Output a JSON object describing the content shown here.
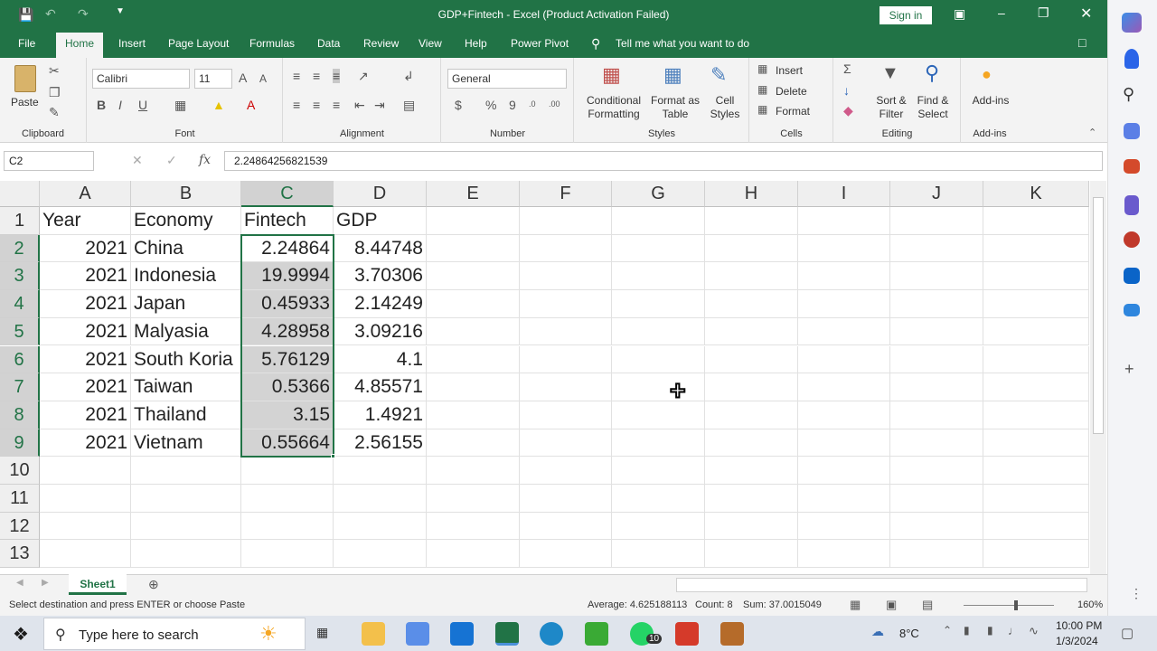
{
  "window": {
    "title": "GDP+Fintech  -  Excel (Product Activation Failed)",
    "sign_in": "Sign in"
  },
  "tabs": [
    "File",
    "Home",
    "Insert",
    "Page Layout",
    "Formulas",
    "Data",
    "Review",
    "View",
    "Help",
    "Power Pivot"
  ],
  "tell_me": "Tell me what you want to do",
  "ribbon": {
    "clipboard": {
      "paste": "Paste",
      "label": "Clipboard"
    },
    "font": {
      "name": "Calibri",
      "size": "11",
      "label": "Font",
      "bold": "B",
      "italic": "I",
      "underline": "U"
    },
    "alignment": {
      "label": "Alignment"
    },
    "number": {
      "format": "General",
      "label": "Number",
      "currency": "$",
      "percent": "%",
      "comma": "9"
    },
    "styles": {
      "conditional": "Conditional Formatting",
      "format_table": "Format as Table",
      "cell_styles": "Cell Styles",
      "label": "Styles"
    },
    "cells": {
      "insert": "Insert",
      "delete": "Delete",
      "format": "Format",
      "label": "Cells"
    },
    "editing": {
      "sort": "Sort & Filter",
      "find": "Find & Select",
      "label": "Editing"
    },
    "addins": {
      "addins": "Add-ins",
      "label": "Add-ins"
    }
  },
  "formula_bar": {
    "name_box": "C2",
    "fx": "fx",
    "value": "2.24864256821539"
  },
  "columns": [
    "A",
    "B",
    "C",
    "D",
    "E",
    "F",
    "G",
    "H",
    "I",
    "J",
    "K"
  ],
  "rows": [
    "1",
    "2",
    "3",
    "4",
    "5",
    "6",
    "7",
    "8",
    "9",
    "10",
    "11",
    "12",
    "13"
  ],
  "cells": [
    [
      "Year",
      "Economy",
      "Fintech",
      "GDP"
    ],
    [
      "2021",
      "China",
      "2.24864",
      "8.44748"
    ],
    [
      "2021",
      "Indonesia",
      "19.9994",
      "3.70306"
    ],
    [
      "2021",
      "Japan",
      "0.45933",
      "2.14249"
    ],
    [
      "2021",
      "Malyasia",
      "4.28958",
      "3.09216"
    ],
    [
      "2021",
      "South Koria",
      "5.76129",
      "4.1"
    ],
    [
      "2021",
      "Taiwan",
      "0.5366",
      "4.85571"
    ],
    [
      "2021",
      "Thailand",
      "3.15",
      "1.4921"
    ],
    [
      "2021",
      "Vietnam",
      "0.55664",
      "2.56155"
    ]
  ],
  "sheet_tab": "Sheet1",
  "status": {
    "message": "Select destination and press ENTER or choose Paste",
    "average": "Average: 4.625188113",
    "count": "Count: 8",
    "sum": "Sum: 37.0015049",
    "zoom": "160%"
  },
  "taskbar": {
    "search": "Type here to search",
    "temp": "8°C",
    "time": "10:00 PM",
    "date": "1/3/2024",
    "badge": "10"
  },
  "colors": {
    "excel_green": "#217346",
    "selection_grey": "#d3d3d3"
  }
}
